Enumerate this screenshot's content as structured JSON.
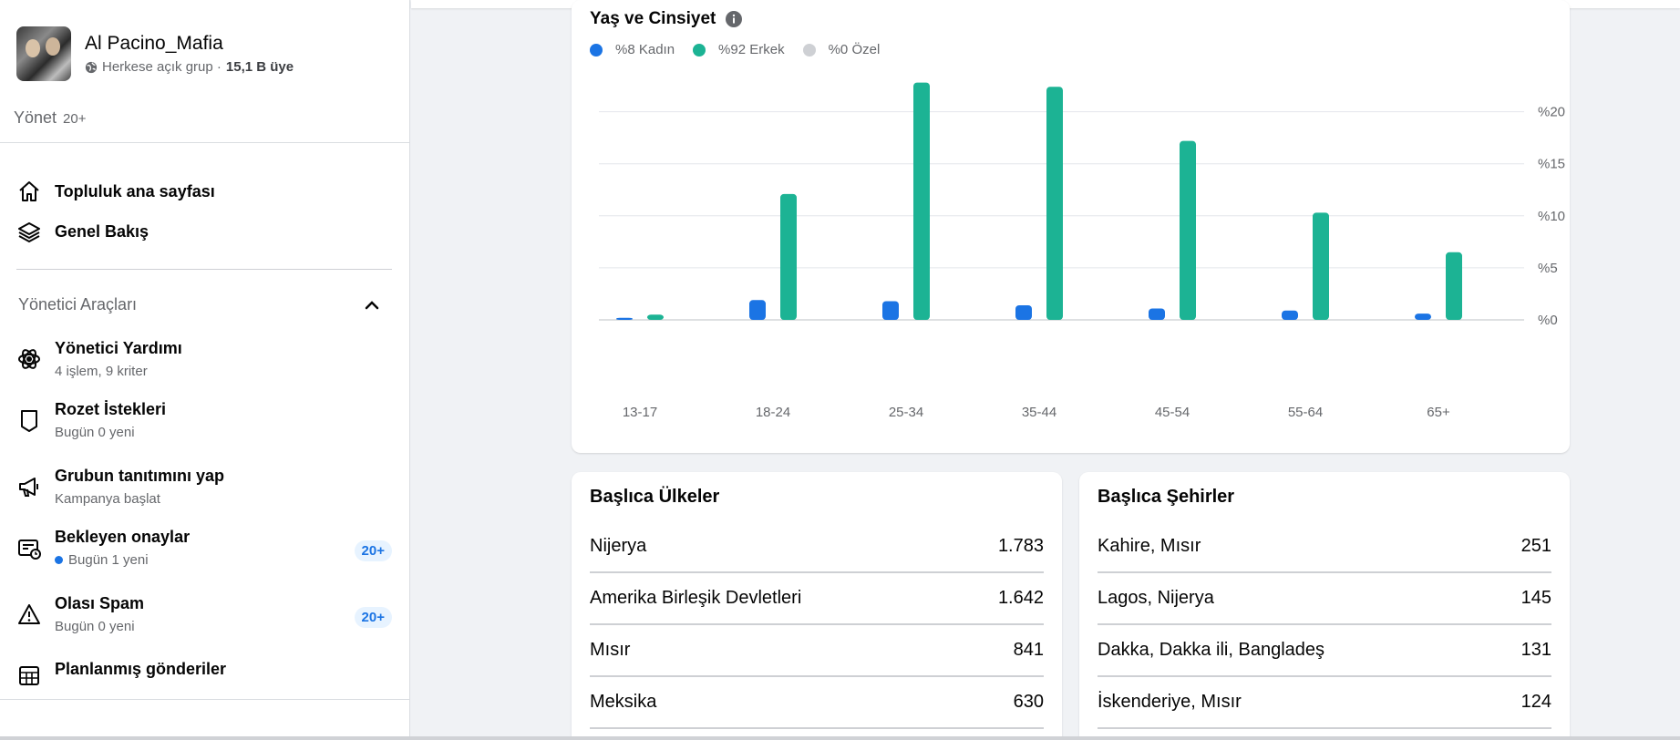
{
  "group": {
    "name": "Al Pacino_Mafia",
    "privacy": "Herkese açık grup · ",
    "members": "15,1 B üye"
  },
  "manage": {
    "label": "Yönet",
    "count": "20+"
  },
  "nav": [
    {
      "label": "Topluluk ana sayfası",
      "icon": "home-icon"
    },
    {
      "label": "Genel Bakış",
      "icon": "layers-icon"
    }
  ],
  "admin_tools": {
    "title": "Yönetici Araçları",
    "items": [
      {
        "title": "Yönetici Yardımı",
        "sub": "4 işlem, 9 kriter",
        "icon": "admin-assist-icon",
        "badge": ""
      },
      {
        "title": "Rozet İstekleri",
        "sub": "Bugün 0 yeni",
        "icon": "badge-shield-icon",
        "badge": ""
      },
      {
        "title": "Grubun tanıtımını yap",
        "sub": "Kampanya başlat",
        "icon": "megaphone-icon",
        "badge": ""
      },
      {
        "title": "Bekleyen onaylar",
        "sub": "Bugün 1 yeni",
        "icon": "pending-approvals-icon",
        "badge": "20+"
      },
      {
        "title": "Olası Spam",
        "sub": "Bugün 0 yeni",
        "icon": "warning-icon",
        "badge": "20+"
      },
      {
        "title": "Planlanmış gönderiler",
        "sub": "",
        "icon": "calendar-grid-icon",
        "badge": ""
      }
    ]
  },
  "age_gender": {
    "title": "Yaş ve Cinsiyet",
    "legend": [
      {
        "label": "%8 Kadın",
        "color": "#1b74e4"
      },
      {
        "label": "%92 Erkek",
        "color": "#1cb394"
      },
      {
        "label": "%0 Özel",
        "color": "#ced0d4"
      }
    ]
  },
  "chart_data": {
    "type": "bar",
    "categories": [
      "13-17",
      "18-24",
      "25-34",
      "35-44",
      "45-54",
      "55-64",
      "65+"
    ],
    "series": [
      {
        "name": "%8 Kadın",
        "color": "#1b74e4",
        "values": [
          0.2,
          1.9,
          1.8,
          1.4,
          1.1,
          0.9,
          0.6
        ]
      },
      {
        "name": "%92 Erkek",
        "color": "#1cb394",
        "values": [
          0.5,
          12.1,
          22.8,
          22.4,
          17.2,
          10.3,
          6.5
        ]
      }
    ],
    "y_ticks": [
      "%0",
      "%5",
      "%10",
      "%15",
      "%20"
    ],
    "ylim": [
      0,
      23
    ],
    "grid": true,
    "y_axis_side": "right",
    "xlabel": "",
    "ylabel": ""
  },
  "countries": {
    "title": "Başlıca Ülkeler",
    "rows": [
      {
        "name": "Nijerya",
        "value": "1.783"
      },
      {
        "name": "Amerika Birleşik Devletleri",
        "value": "1.642"
      },
      {
        "name": "Mısır",
        "value": "841"
      },
      {
        "name": "Meksika",
        "value": "630"
      }
    ]
  },
  "cities": {
    "title": "Başlıca Şehirler",
    "rows": [
      {
        "name": "Kahire, Mısır",
        "value": "251"
      },
      {
        "name": "Lagos, Nijerya",
        "value": "145"
      },
      {
        "name": "Dakka, Dakka ili, Bangladeş",
        "value": "131"
      },
      {
        "name": "İskenderiye, Mısır",
        "value": "124"
      }
    ]
  }
}
